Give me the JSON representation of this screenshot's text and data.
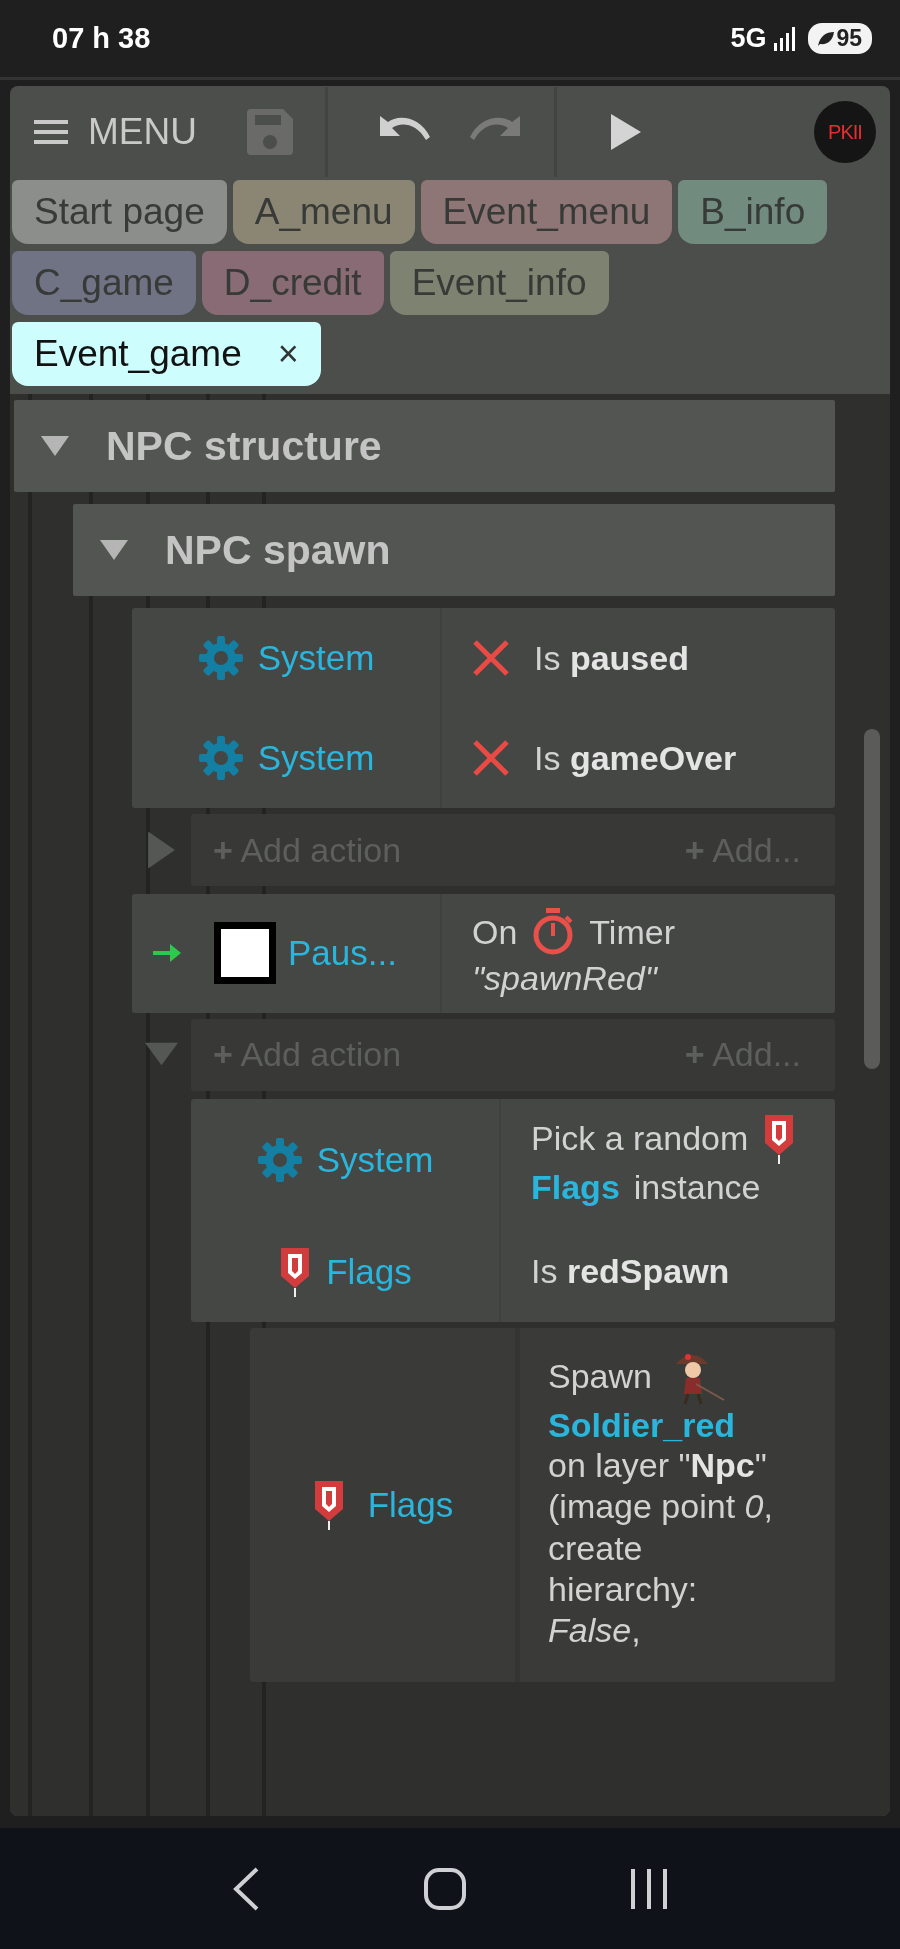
{
  "status_bar": {
    "time": "07 h 38",
    "network": "5G",
    "battery": "95"
  },
  "toolbar": {
    "menu_label": "MENU",
    "save_disabled": true,
    "redo_disabled": true,
    "logo_text": "PKII"
  },
  "tabs": [
    {
      "label": "Start page",
      "color": "#8b8e8a",
      "selected": false
    },
    {
      "label": "A_menu",
      "color": "#8b8674",
      "selected": false
    },
    {
      "label": "Event_menu",
      "color": "#8f7676",
      "selected": false
    },
    {
      "label": "B_info",
      "color": "#718c7e",
      "selected": false
    },
    {
      "label": "C_game",
      "color": "#6f7384",
      "selected": false
    },
    {
      "label": "D_credit",
      "color": "#886b74",
      "selected": false
    },
    {
      "label": "Event_info",
      "color": "#7d8370",
      "selected": false
    },
    {
      "label": "Event_game",
      "color": "#cdfdfd",
      "selected": true,
      "close": "×"
    }
  ],
  "sheet": {
    "groups": [
      {
        "title": "NPC structure",
        "expanded": true,
        "children": [
          {
            "title": "NPC spawn",
            "expanded": true,
            "children": [
              {
                "trigger": false,
                "conditions": [
                  {
                    "object": "System",
                    "kind": "system",
                    "inverted": true,
                    "parts": [
                      {
                        "kind": "text",
                        "text": "Is **paused**"
                      }
                    ]
                  },
                  {
                    "object": "System",
                    "kind": "system",
                    "inverted": true,
                    "parts": [
                      {
                        "kind": "text",
                        "text": "Is **gameOver**"
                      }
                    ]
                  }
                ],
                "actions_expanded": false,
                "plus": "+",
                "add_action": "Add action",
                "plus_more": "+",
                "add_more": "Add..."
              },
              {
                "trigger": true,
                "conditions": [
                  {
                    "object": "Paus...",
                    "kind": "sprite",
                    "inverted": false,
                    "parts": [
                      {
                        "kind": "text",
                        "text": "On"
                      },
                      {
                        "kind": "timer"
                      },
                      {
                        "kind": "text",
                        "text": "Timer"
                      },
                      {
                        "kind": "param",
                        "text": "\"spawnRed\""
                      }
                    ]
                  }
                ],
                "actions_expanded": true,
                "plus": "+",
                "add_action": "Add action",
                "plus_more": "+",
                "add_more": "Add...",
                "children": [
                  {
                    "trigger": false,
                    "conditions": [
                      {
                        "object": "System",
                        "kind": "system",
                        "inverted": false,
                        "parts": [
                          {
                            "kind": "text",
                            "text": "Pick a random"
                          },
                          {
                            "kind": "flag"
                          },
                          {
                            "kind": "object",
                            "text": "Flags"
                          },
                          {
                            "kind": "text",
                            "text": "instance"
                          }
                        ]
                      },
                      {
                        "object": "Flags",
                        "kind": "flag",
                        "inverted": false,
                        "parts": [
                          {
                            "kind": "text",
                            "text": "Is **redSpawn**"
                          }
                        ]
                      }
                    ],
                    "actions": [
                      {
                        "object": "Flags",
                        "kind": "flag",
                        "parts": [
                          {
                            "kind": "text",
                            "text": "Spawn"
                          },
                          {
                            "kind": "soldier"
                          },
                          {
                            "kind": "object",
                            "text": "Soldier_red"
                          },
                          {
                            "kind": "text",
                            "text": "on layer \"**Npc**\" (image point *0*, create hierarchy: *False*,"
                          }
                        ]
                      }
                    ]
                  }
                ]
              }
            ]
          }
        ]
      }
    ]
  }
}
